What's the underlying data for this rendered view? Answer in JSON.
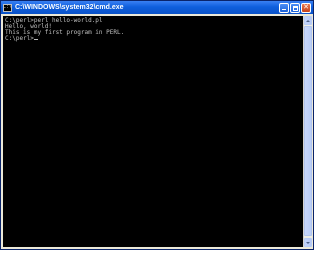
{
  "window": {
    "title": "C:\\WINDOWS\\system32\\cmd.exe",
    "icon": "cmd-icon",
    "controls": {
      "minimize_icon": "minimize-icon",
      "maximize_icon": "maximize-icon",
      "close_icon": "close-icon",
      "close_glyph": "✕"
    },
    "colors": {
      "titlebar": "#0f5fdd",
      "console_background": "#000000",
      "console_text": "#c0c0c0"
    }
  },
  "console": {
    "lines": [
      "C:\\perl>perl hello-world.pl",
      "Hello, world!",
      "This is my first program in PERL.",
      "C:\\perl>"
    ]
  }
}
